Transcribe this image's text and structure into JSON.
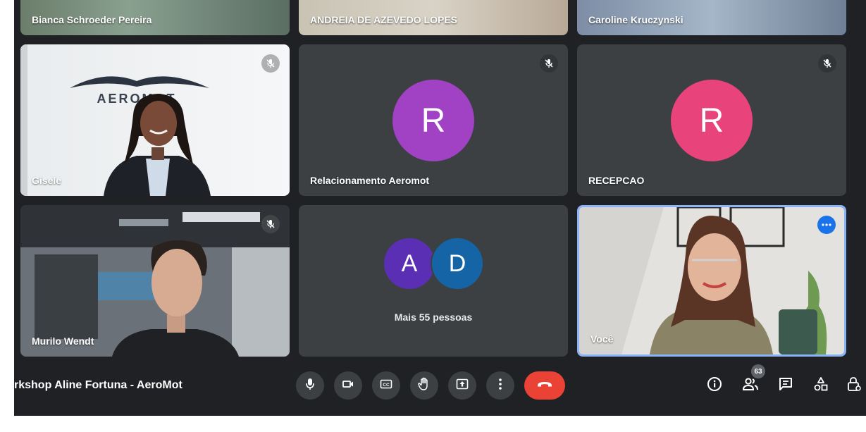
{
  "meeting": {
    "title": "rkshop Aline Fortuna - AeroMot"
  },
  "participants": {
    "top": [
      {
        "name": "Bianca Schroeder Pereira"
      },
      {
        "name": "ANDREIA DE AZEVEDO LOPES"
      },
      {
        "name": "Caroline Kruczynski"
      }
    ],
    "gisele": {
      "name": "Gisele",
      "wall_logo": "AEROMOT"
    },
    "relacionamento": {
      "name": "Relacionamento Aeromot",
      "initial": "R",
      "color": "#a142c4"
    },
    "recepcao": {
      "name": "RECEPCAO",
      "initial": "R",
      "color": "#e8437a"
    },
    "murilo": {
      "name": "Murilo Wendt"
    },
    "group": {
      "initial_a": "A",
      "initial_d": "D",
      "color_a": "#5b2fb3",
      "color_d": "#1565a6",
      "label": "Mais 55 pessoas"
    },
    "self": {
      "name": "Você"
    }
  },
  "controls": {
    "icons": [
      "microphone-icon",
      "camera-icon",
      "captions-icon",
      "raise-hand-icon",
      "present-icon",
      "more-options-icon",
      "end-call-icon"
    ],
    "people_count": "63",
    "end_color": "#ea4335"
  },
  "accent_color": "#8ab4f8"
}
